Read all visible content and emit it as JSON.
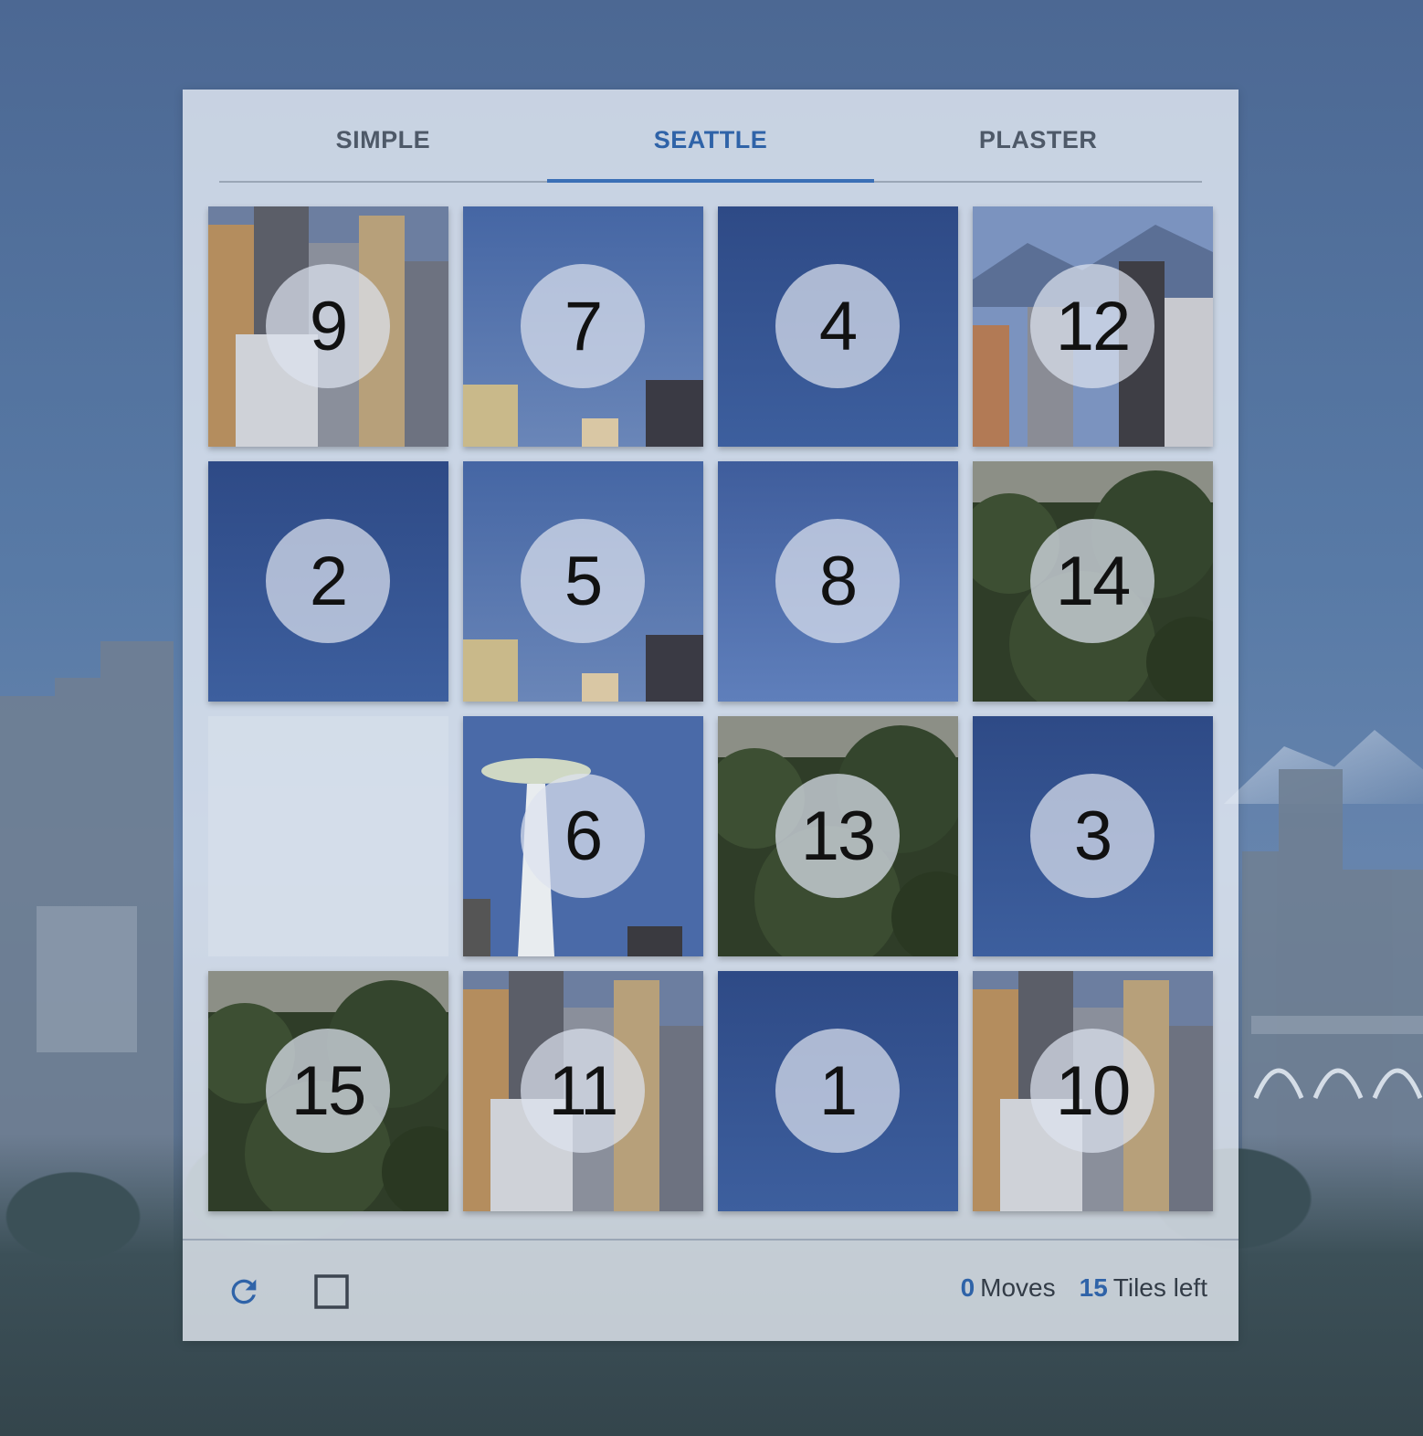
{
  "tabs": [
    {
      "label": "SIMPLE",
      "active": false
    },
    {
      "label": "SEATTLE",
      "active": true
    },
    {
      "label": "PLASTER",
      "active": false
    }
  ],
  "board": {
    "rows": 4,
    "cols": 4,
    "grid": [
      [
        9,
        7,
        4,
        12
      ],
      [
        2,
        5,
        8,
        14
      ],
      [
        null,
        6,
        13,
        3
      ],
      [
        15,
        11,
        1,
        10
      ]
    ],
    "tiles": [
      {
        "label": "9",
        "scene": "buildings"
      },
      {
        "label": "7",
        "scene": "sky-low-building"
      },
      {
        "label": "4",
        "scene": "sky-dark"
      },
      {
        "label": "12",
        "scene": "mountains-buildings"
      },
      {
        "label": "2",
        "scene": "sky-dark"
      },
      {
        "label": "5",
        "scene": "sky-low-building"
      },
      {
        "label": "8",
        "scene": "sky"
      },
      {
        "label": "14",
        "scene": "trees"
      },
      {
        "label": "6",
        "scene": "space-needle"
      },
      {
        "label": "13",
        "scene": "trees"
      },
      {
        "label": "3",
        "scene": "sky-dark"
      },
      {
        "label": "15",
        "scene": "trees"
      },
      {
        "label": "11",
        "scene": "buildings"
      },
      {
        "label": "1",
        "scene": "sky-dark"
      },
      {
        "label": "10",
        "scene": "buildings"
      }
    ]
  },
  "footer": {
    "reset_icon": "refresh-icon",
    "toggle_icon": "square-outline-icon",
    "moves_count": "0",
    "moves_label": "Moves",
    "tiles_left_count": "15",
    "tiles_left_label": "Tiles left"
  },
  "colors": {
    "accent": "#2f63a8",
    "sky_dark": "#2e4a86",
    "sky": "#4d6fae",
    "trees": "#2f3d28"
  }
}
